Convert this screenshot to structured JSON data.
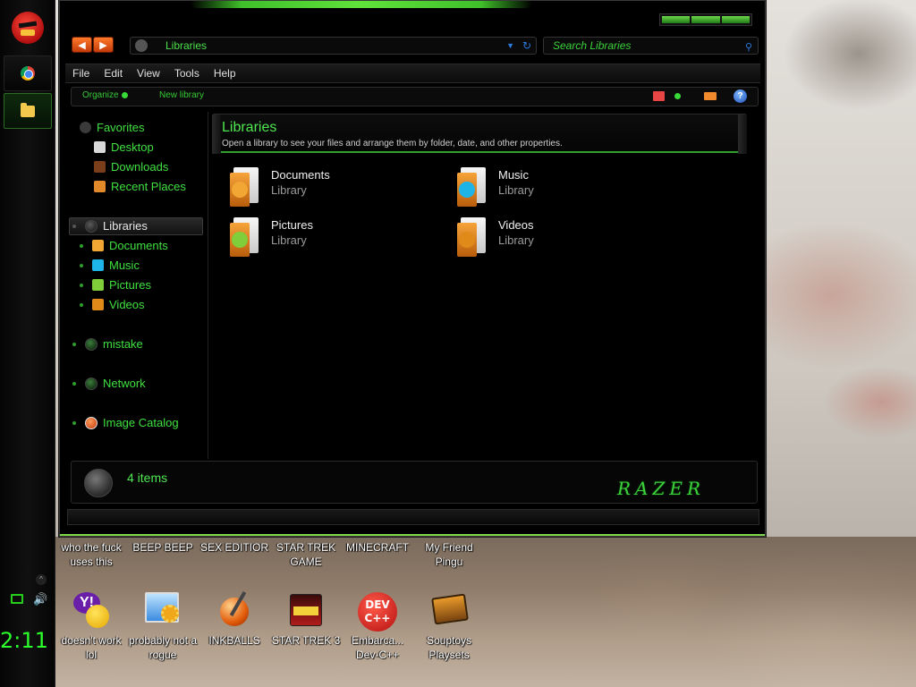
{
  "window": {
    "address": "Libraries",
    "search_placeholder": "Search Libraries",
    "menu": [
      "File",
      "Edit",
      "View",
      "Tools",
      "Help"
    ],
    "toolbar": {
      "organize": "Organize",
      "new_library": "New library",
      "help": "?"
    },
    "header": {
      "title": "Libraries",
      "subtitle": "Open a library to see your files and arrange them by folder, date, and other properties."
    },
    "nav": {
      "favorites": "Favorites",
      "desktop": "Desktop",
      "downloads": "Downloads",
      "recent": "Recent Places",
      "libraries": "Libraries",
      "documents": "Documents",
      "music": "Music",
      "pictures": "Pictures",
      "videos": "Videos",
      "mistake": "mistake",
      "network": "Network",
      "image_catalog": "Image Catalog"
    },
    "libraries": [
      {
        "name": "Documents",
        "type": "Library",
        "badge_icon": "document-badge",
        "badge_color": "#f2a634"
      },
      {
        "name": "Music",
        "type": "Library",
        "badge_icon": "music-badge",
        "badge_color": "#1fb4e8"
      },
      {
        "name": "Pictures",
        "type": "Library",
        "badge_icon": "picture-badge",
        "badge_color": "#7fce3a"
      },
      {
        "name": "Videos",
        "type": "Library",
        "badge_icon": "video-badge",
        "badge_color": "#e08a1a"
      }
    ],
    "status": "4 items",
    "brand": "RAZER"
  },
  "desktop": {
    "top_labels": [
      "who the fuck uses this",
      "BEEP BEEP",
      "SEX EDITIOR",
      "STAR TREK GAME",
      "MINECRAFT",
      "My Friend Pingu"
    ],
    "icons": [
      {
        "label": "doesn't work lol",
        "icon": "yahoo-messenger-icon"
      },
      {
        "label": "probably not a rogue",
        "icon": "settings-app-icon"
      },
      {
        "label": "INKBALLS",
        "icon": "inkball-icon"
      },
      {
        "label": "STAR TREK 3",
        "icon": "star-wars-icon"
      },
      {
        "label": "Embarca... Dev-C++",
        "icon": "dev-cpp-icon"
      },
      {
        "label": "Souptoys Playsets",
        "icon": "souptoys-icon"
      }
    ],
    "dev_cpp_badge": "DEV C++"
  },
  "taskbar": {
    "clock": "2:11",
    "accent": "#2bff2b"
  }
}
